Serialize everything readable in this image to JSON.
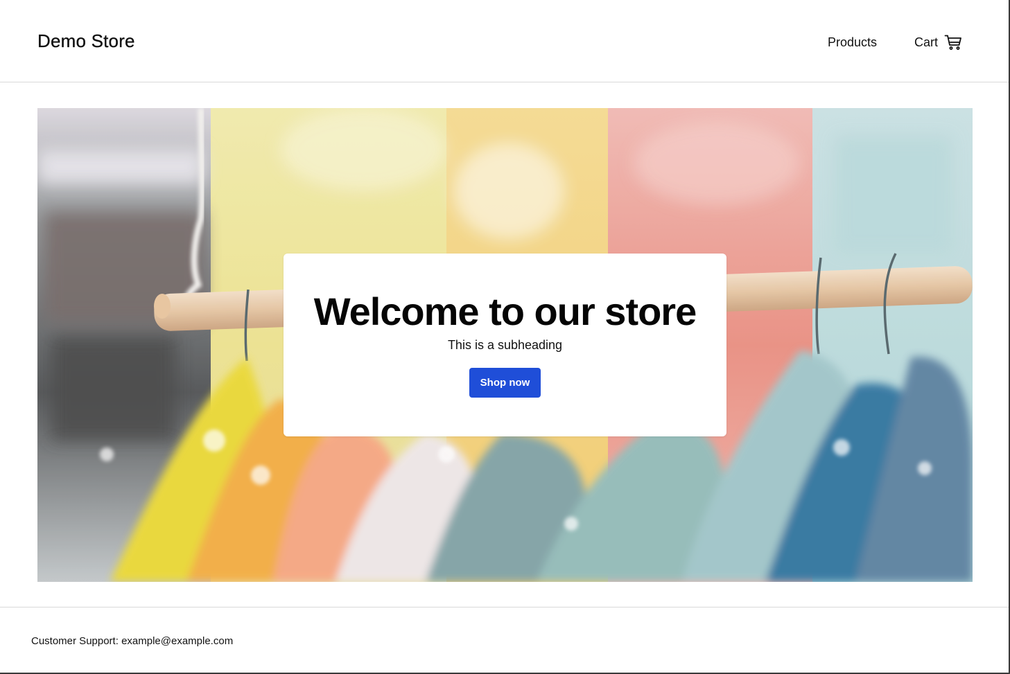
{
  "header": {
    "brand": "Demo Store",
    "nav": {
      "products_label": "Products",
      "cart_label": "Cart",
      "cart_icon": "cart-icon"
    }
  },
  "hero": {
    "title": "Welcome to our store",
    "subtitle": "This is a subheading",
    "cta_label": "Shop now",
    "cta_color": "#1f4ed8",
    "image_alt": "Colorful jackets hanging on a rack"
  },
  "footer": {
    "support_label": "Customer Support:",
    "support_email": "example@example.com"
  }
}
